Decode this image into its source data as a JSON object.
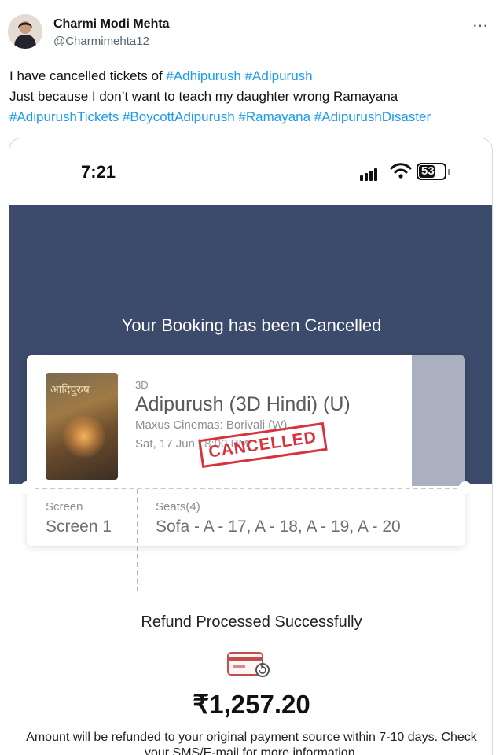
{
  "tweet": {
    "author_name": "Charmi Modi Mehta",
    "author_handle": "@Charmimehta12",
    "more_icon": "more-horizontal-icon",
    "line1_text": "I have cancelled tickets of ",
    "line1_tags": [
      "#Adhipurush",
      "#Adipurush"
    ],
    "line2_text": "Just because I don’t want to teach my daughter wrong Ramayana",
    "line3_tags": [
      "#AdipurushTickets",
      "#BoycottAdipurush",
      "#Ramayana",
      "#AdipurushDisaster"
    ],
    "link_color": "#1d9bf0"
  },
  "screenshot": {
    "status_time": "7:21",
    "battery_level": "53",
    "status_icons": [
      "signal-icon",
      "wifi-icon",
      "battery-icon"
    ],
    "banner_color": "#3c4a6b",
    "cancel_title": "Your Booking has been Cancelled",
    "ticket": {
      "poster_title": "आदिपुरुष",
      "format": "3D",
      "movie_title": "Adipurush (3D Hindi) (U)",
      "cinema": "Maxus Cinemas: Borivali (W)",
      "showtime": "Sat, 17 Jun | 8:00 PM",
      "stamp": "CANCELLED",
      "stamp_color": "#d6333f",
      "screen_label": "Screen",
      "screen_value": "Screen 1",
      "seats_label": "Seats(4)",
      "seats_value": "Sofa - A - 17, A - 18, A - 19, A - 20"
    },
    "refund_title": "Refund Processed Successfully",
    "refund_icon": "card-refund-icon",
    "refund_amount": "₹1,257.20",
    "refund_note": "Amount will be refunded to your original payment source within 7-10 days. Check your SMS/E-mail for more information."
  }
}
